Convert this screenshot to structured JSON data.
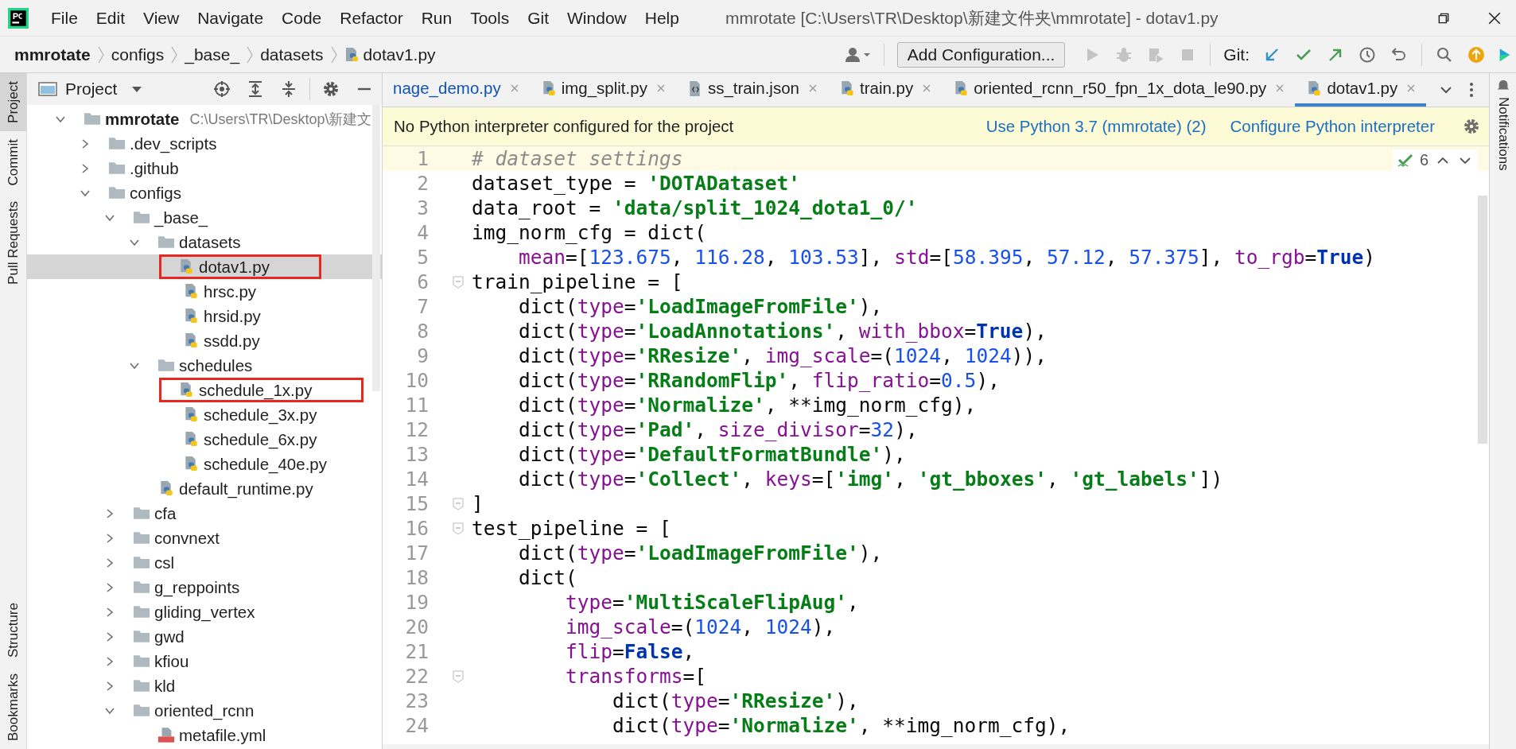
{
  "window": {
    "title": "mmrotate [C:\\Users\\TR\\Desktop\\新建文件夹\\mmrotate] - dotav1.py"
  },
  "menu": [
    "File",
    "Edit",
    "View",
    "Navigate",
    "Code",
    "Refactor",
    "Run",
    "Tools",
    "Git",
    "Window",
    "Help"
  ],
  "breadcrumb": [
    "mmrotate",
    "configs",
    "_base_",
    "datasets",
    "dotav1.py"
  ],
  "toolbar": {
    "run_config": "Add Configuration...",
    "git_label": "Git:"
  },
  "left_strip": [
    {
      "label": "Project",
      "selected": true
    },
    {
      "label": "Commit",
      "selected": false
    },
    {
      "label": "Pull Requests",
      "selected": false
    },
    {
      "label": "Structure",
      "selected": false
    },
    {
      "label": "Bookmarks",
      "selected": false
    }
  ],
  "right_strip": [
    {
      "label": "Notifications"
    }
  ],
  "project_panel": {
    "title": "Project"
  },
  "project_tree": [
    {
      "label": "mmrotate",
      "note": "C:\\Users\\TR\\Desktop\\新建文",
      "kind": "folder",
      "expanded": true,
      "selected": false,
      "annotated": false,
      "children": [
        {
          "label": ".dev_scripts",
          "kind": "folder",
          "expanded": false,
          "selected": false,
          "annotated": false
        },
        {
          "label": ".github",
          "kind": "folder",
          "expanded": false,
          "selected": false,
          "annotated": false
        },
        {
          "label": "configs",
          "kind": "folder",
          "expanded": true,
          "selected": false,
          "annotated": false,
          "children": [
            {
              "label": "_base_",
              "kind": "folder",
              "expanded": true,
              "selected": false,
              "annotated": false,
              "children": [
                {
                  "label": "datasets",
                  "kind": "folder",
                  "expanded": true,
                  "selected": false,
                  "annotated": false,
                  "children": [
                    {
                      "label": "dotav1.py",
                      "kind": "py",
                      "selected": true,
                      "annotated": true
                    },
                    {
                      "label": "hrsc.py",
                      "kind": "py",
                      "selected": false,
                      "annotated": false
                    },
                    {
                      "label": "hrsid.py",
                      "kind": "py",
                      "selected": false,
                      "annotated": false
                    },
                    {
                      "label": "ssdd.py",
                      "kind": "py",
                      "selected": false,
                      "annotated": false
                    }
                  ]
                },
                {
                  "label": "schedules",
                  "kind": "folder",
                  "expanded": true,
                  "selected": false,
                  "annotated": false,
                  "children": [
                    {
                      "label": "schedule_1x.py",
                      "kind": "py",
                      "selected": false,
                      "annotated": true
                    },
                    {
                      "label": "schedule_3x.py",
                      "kind": "py",
                      "selected": false,
                      "annotated": false
                    },
                    {
                      "label": "schedule_6x.py",
                      "kind": "py",
                      "selected": false,
                      "annotated": false
                    },
                    {
                      "label": "schedule_40e.py",
                      "kind": "py",
                      "selected": false,
                      "annotated": false
                    }
                  ]
                },
                {
                  "label": "default_runtime.py",
                  "kind": "py",
                  "selected": false,
                  "annotated": false
                }
              ]
            },
            {
              "label": "cfa",
              "kind": "folder",
              "expanded": false,
              "selected": false,
              "annotated": false
            },
            {
              "label": "convnext",
              "kind": "folder",
              "expanded": false,
              "selected": false,
              "annotated": false
            },
            {
              "label": "csl",
              "kind": "folder",
              "expanded": false,
              "selected": false,
              "annotated": false
            },
            {
              "label": "g_reppoints",
              "kind": "folder",
              "expanded": false,
              "selected": false,
              "annotated": false
            },
            {
              "label": "gliding_vertex",
              "kind": "folder",
              "expanded": false,
              "selected": false,
              "annotated": false
            },
            {
              "label": "gwd",
              "kind": "folder",
              "expanded": false,
              "selected": false,
              "annotated": false
            },
            {
              "label": "kfiou",
              "kind": "folder",
              "expanded": false,
              "selected": false,
              "annotated": false
            },
            {
              "label": "kld",
              "kind": "folder",
              "expanded": false,
              "selected": false,
              "annotated": false
            },
            {
              "label": "oriented_rcnn",
              "kind": "folder",
              "expanded": true,
              "selected": false,
              "annotated": false,
              "children": [
                {
                  "label": "metafile.yml",
                  "kind": "yml",
                  "selected": false,
                  "annotated": false
                }
              ]
            }
          ]
        }
      ]
    }
  ],
  "tabs": [
    {
      "label": "nage_demo.py",
      "modified": true,
      "selected": false
    },
    {
      "label": "img_split.py",
      "kind": "py",
      "modified": false,
      "selected": false
    },
    {
      "label": "ss_train.json",
      "kind": "json",
      "modified": false,
      "selected": false
    },
    {
      "label": "train.py",
      "kind": "py",
      "modified": false,
      "selected": false
    },
    {
      "label": "oriented_rcnn_r50_fpn_1x_dota_le90.py",
      "kind": "py",
      "modified": false,
      "selected": false
    },
    {
      "label": "dotav1.py",
      "kind": "py",
      "modified": false,
      "selected": true
    }
  ],
  "banner": {
    "message": "No Python interpreter configured for the project",
    "links": [
      "Use Python 3.7 (mmrotate) (2)",
      "Configure Python interpreter"
    ]
  },
  "inspections": {
    "count": "6"
  },
  "code": [
    {
      "n": "1",
      "current": true,
      "fold": false,
      "tokens": [
        {
          "kind": "comment",
          "text": "# dataset settings"
        }
      ]
    },
    {
      "n": "2",
      "current": false,
      "fold": false,
      "tokens": [
        {
          "kind": "plain",
          "text": "dataset_type = "
        },
        {
          "kind": "string",
          "text": "'DOTADataset'"
        }
      ]
    },
    {
      "n": "3",
      "current": false,
      "fold": false,
      "tokens": [
        {
          "kind": "plain",
          "text": "data_root = "
        },
        {
          "kind": "string",
          "text": "'data/split_1024_dota1_0/'"
        }
      ]
    },
    {
      "n": "4",
      "current": false,
      "fold": false,
      "tokens": [
        {
          "kind": "plain",
          "text": "img_norm_cfg = dict("
        }
      ]
    },
    {
      "n": "5",
      "current": false,
      "fold": false,
      "tokens": [
        {
          "kind": "param",
          "text": "    mean"
        },
        {
          "kind": "plain",
          "text": "=["
        },
        {
          "kind": "number",
          "text": "123.675"
        },
        {
          "kind": "plain",
          "text": ", "
        },
        {
          "kind": "number",
          "text": "116.28"
        },
        {
          "kind": "plain",
          "text": ", "
        },
        {
          "kind": "number",
          "text": "103.53"
        },
        {
          "kind": "plain",
          "text": "], "
        },
        {
          "kind": "param",
          "text": "std"
        },
        {
          "kind": "plain",
          "text": "=["
        },
        {
          "kind": "number",
          "text": "58.395"
        },
        {
          "kind": "plain",
          "text": ", "
        },
        {
          "kind": "number",
          "text": "57.12"
        },
        {
          "kind": "plain",
          "text": ", "
        },
        {
          "kind": "number",
          "text": "57.375"
        },
        {
          "kind": "plain",
          "text": "], "
        },
        {
          "kind": "param",
          "text": "to_rgb"
        },
        {
          "kind": "plain",
          "text": "="
        },
        {
          "kind": "keyword",
          "text": "True"
        },
        {
          "kind": "plain",
          "text": ")"
        }
      ]
    },
    {
      "n": "6",
      "current": false,
      "fold": true,
      "tokens": [
        {
          "kind": "plain",
          "text": "train_pipeline = ["
        }
      ]
    },
    {
      "n": "7",
      "current": false,
      "fold": false,
      "tokens": [
        {
          "kind": "plain",
          "text": "    dict("
        },
        {
          "kind": "param",
          "text": "type"
        },
        {
          "kind": "plain",
          "text": "="
        },
        {
          "kind": "string",
          "text": "'LoadImageFromFile'"
        },
        {
          "kind": "plain",
          "text": "),"
        }
      ]
    },
    {
      "n": "8",
      "current": false,
      "fold": false,
      "tokens": [
        {
          "kind": "plain",
          "text": "    dict("
        },
        {
          "kind": "param",
          "text": "type"
        },
        {
          "kind": "plain",
          "text": "="
        },
        {
          "kind": "string",
          "text": "'LoadAnnotations'"
        },
        {
          "kind": "plain",
          "text": ", "
        },
        {
          "kind": "param",
          "text": "with_bbox"
        },
        {
          "kind": "plain",
          "text": "="
        },
        {
          "kind": "keyword",
          "text": "True"
        },
        {
          "kind": "plain",
          "text": "),"
        }
      ]
    },
    {
      "n": "9",
      "current": false,
      "fold": false,
      "tokens": [
        {
          "kind": "plain",
          "text": "    dict("
        },
        {
          "kind": "param",
          "text": "type"
        },
        {
          "kind": "plain",
          "text": "="
        },
        {
          "kind": "string",
          "text": "'RResize'"
        },
        {
          "kind": "plain",
          "text": ", "
        },
        {
          "kind": "param",
          "text": "img_scale"
        },
        {
          "kind": "plain",
          "text": "=("
        },
        {
          "kind": "number",
          "text": "1024"
        },
        {
          "kind": "plain",
          "text": ", "
        },
        {
          "kind": "number",
          "text": "1024"
        },
        {
          "kind": "plain",
          "text": ")),"
        }
      ]
    },
    {
      "n": "10",
      "current": false,
      "fold": false,
      "tokens": [
        {
          "kind": "plain",
          "text": "    dict("
        },
        {
          "kind": "param",
          "text": "type"
        },
        {
          "kind": "plain",
          "text": "="
        },
        {
          "kind": "string",
          "text": "'RRandomFlip'"
        },
        {
          "kind": "plain",
          "text": ", "
        },
        {
          "kind": "param",
          "text": "flip_ratio"
        },
        {
          "kind": "plain",
          "text": "="
        },
        {
          "kind": "number",
          "text": "0.5"
        },
        {
          "kind": "plain",
          "text": "),"
        }
      ]
    },
    {
      "n": "11",
      "current": false,
      "fold": false,
      "tokens": [
        {
          "kind": "plain",
          "text": "    dict("
        },
        {
          "kind": "param",
          "text": "type"
        },
        {
          "kind": "plain",
          "text": "="
        },
        {
          "kind": "string",
          "text": "'Normalize'"
        },
        {
          "kind": "plain",
          "text": ", **img_norm_cfg),"
        }
      ]
    },
    {
      "n": "12",
      "current": false,
      "fold": false,
      "tokens": [
        {
          "kind": "plain",
          "text": "    dict("
        },
        {
          "kind": "param",
          "text": "type"
        },
        {
          "kind": "plain",
          "text": "="
        },
        {
          "kind": "string",
          "text": "'Pad'"
        },
        {
          "kind": "plain",
          "text": ", "
        },
        {
          "kind": "param",
          "text": "size_divisor"
        },
        {
          "kind": "plain",
          "text": "="
        },
        {
          "kind": "number",
          "text": "32"
        },
        {
          "kind": "plain",
          "text": "),"
        }
      ]
    },
    {
      "n": "13",
      "current": false,
      "fold": false,
      "tokens": [
        {
          "kind": "plain",
          "text": "    dict("
        },
        {
          "kind": "param",
          "text": "type"
        },
        {
          "kind": "plain",
          "text": "="
        },
        {
          "kind": "string",
          "text": "'DefaultFormatBundle'"
        },
        {
          "kind": "plain",
          "text": "),"
        }
      ]
    },
    {
      "n": "14",
      "current": false,
      "fold": false,
      "tokens": [
        {
          "kind": "plain",
          "text": "    dict("
        },
        {
          "kind": "param",
          "text": "type"
        },
        {
          "kind": "plain",
          "text": "="
        },
        {
          "kind": "string",
          "text": "'Collect'"
        },
        {
          "kind": "plain",
          "text": ", "
        },
        {
          "kind": "param",
          "text": "keys"
        },
        {
          "kind": "plain",
          "text": "=["
        },
        {
          "kind": "string",
          "text": "'img'"
        },
        {
          "kind": "plain",
          "text": ", "
        },
        {
          "kind": "string",
          "text": "'gt_bboxes'"
        },
        {
          "kind": "plain",
          "text": ", "
        },
        {
          "kind": "string",
          "text": "'gt_labels'"
        },
        {
          "kind": "plain",
          "text": "])"
        }
      ]
    },
    {
      "n": "15",
      "current": false,
      "fold": true,
      "tokens": [
        {
          "kind": "plain",
          "text": "]"
        }
      ]
    },
    {
      "n": "16",
      "current": false,
      "fold": true,
      "tokens": [
        {
          "kind": "plain",
          "text": "test_pipeline = ["
        }
      ]
    },
    {
      "n": "17",
      "current": false,
      "fold": false,
      "tokens": [
        {
          "kind": "plain",
          "text": "    dict("
        },
        {
          "kind": "param",
          "text": "type"
        },
        {
          "kind": "plain",
          "text": "="
        },
        {
          "kind": "string",
          "text": "'LoadImageFromFile'"
        },
        {
          "kind": "plain",
          "text": "),"
        }
      ]
    },
    {
      "n": "18",
      "current": false,
      "fold": false,
      "tokens": [
        {
          "kind": "plain",
          "text": "    dict("
        }
      ]
    },
    {
      "n": "19",
      "current": false,
      "fold": false,
      "tokens": [
        {
          "kind": "param",
          "text": "        type"
        },
        {
          "kind": "plain",
          "text": "="
        },
        {
          "kind": "string",
          "text": "'MultiScaleFlipAug'"
        },
        {
          "kind": "plain",
          "text": ","
        }
      ]
    },
    {
      "n": "20",
      "current": false,
      "fold": false,
      "tokens": [
        {
          "kind": "param",
          "text": "        img_scale"
        },
        {
          "kind": "plain",
          "text": "=("
        },
        {
          "kind": "number",
          "text": "1024"
        },
        {
          "kind": "plain",
          "text": ", "
        },
        {
          "kind": "number",
          "text": "1024"
        },
        {
          "kind": "plain",
          "text": "),"
        }
      ]
    },
    {
      "n": "21",
      "current": false,
      "fold": false,
      "tokens": [
        {
          "kind": "param",
          "text": "        flip"
        },
        {
          "kind": "plain",
          "text": "="
        },
        {
          "kind": "keyword",
          "text": "False"
        },
        {
          "kind": "plain",
          "text": ","
        }
      ]
    },
    {
      "n": "22",
      "current": false,
      "fold": true,
      "tokens": [
        {
          "kind": "param",
          "text": "        transforms"
        },
        {
          "kind": "plain",
          "text": "=["
        }
      ]
    },
    {
      "n": "23",
      "current": false,
      "fold": false,
      "tokens": [
        {
          "kind": "plain",
          "text": "            dict("
        },
        {
          "kind": "param",
          "text": "type"
        },
        {
          "kind": "plain",
          "text": "="
        },
        {
          "kind": "string",
          "text": "'RResize'"
        },
        {
          "kind": "plain",
          "text": "),"
        }
      ]
    },
    {
      "n": "24",
      "current": false,
      "fold": false,
      "tokens": [
        {
          "kind": "plain",
          "text": "            dict("
        },
        {
          "kind": "param",
          "text": "type"
        },
        {
          "kind": "plain",
          "text": "="
        },
        {
          "kind": "string",
          "text": "'Normalize'"
        },
        {
          "kind": "plain",
          "text": ", **img_norm_cfg),"
        }
      ]
    }
  ]
}
